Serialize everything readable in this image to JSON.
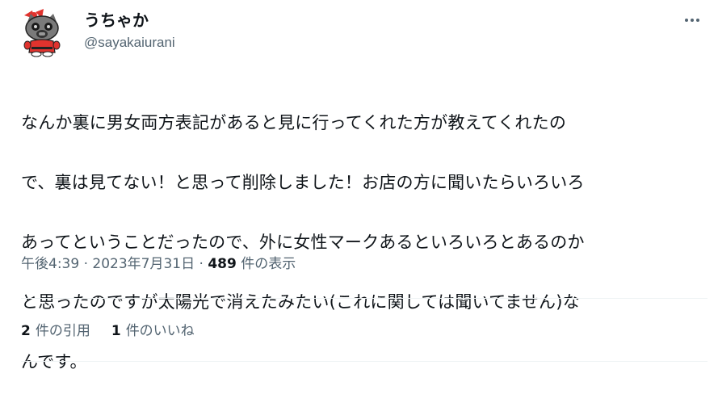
{
  "author": {
    "display_name": "うちゃか",
    "handle": "@sayakaiurani",
    "avatar_icon": "masked-cat-avatar-icon"
  },
  "menu_icon": "more-horizontal-icon",
  "tweet": {
    "text_lines": [
      "なんか裏に男女両方表記があると見に行ってくれた方が教えてくれたの",
      "で、裏は見てない！と思って削除しました！お店の方に聞いたらいろいろ",
      "あってということだったので、外に女性マークあるといろいろとあるのか",
      "と思ったのですが太陽光で消えたみたい(これに関しては聞いてません)な",
      "んです。"
    ]
  },
  "meta": {
    "time": "午後4:39",
    "separator": " · ",
    "date": "2023年7月31日",
    "views_count": "489",
    "views_label": " 件の表示"
  },
  "stats": {
    "quotes_count": "2",
    "quotes_label": "件の引用",
    "likes_count": "1",
    "likes_label": "件のいいね"
  },
  "colors": {
    "text_primary": "#0f1419",
    "text_secondary": "#536471",
    "divider": "#eff3f4",
    "avatar_accent": "#e0332e"
  }
}
